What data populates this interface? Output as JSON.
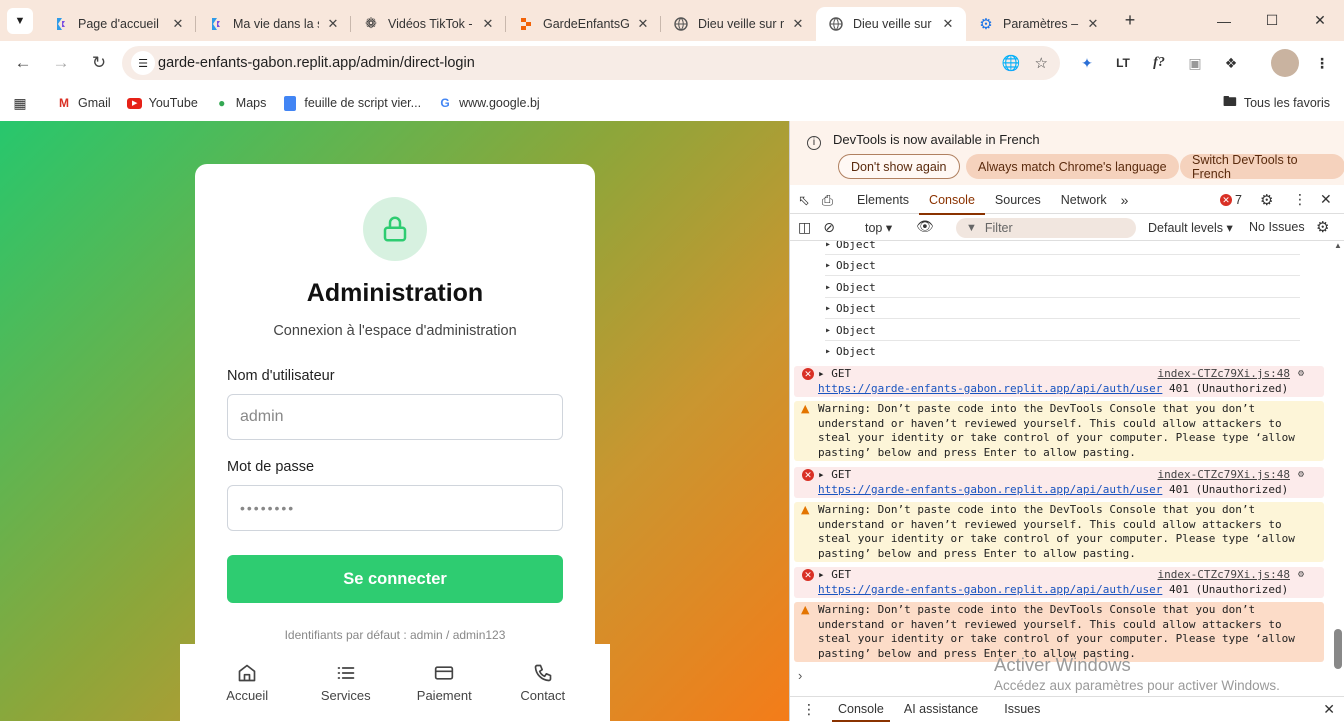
{
  "browser": {
    "tabs": [
      {
        "title": "Page d'accueil",
        "icon": "replit-icon"
      },
      {
        "title": "Ma vie dans la s",
        "icon": "replit-icon"
      },
      {
        "title": "Vidéos TikTok -",
        "icon": "chatgpt-icon"
      },
      {
        "title": "GardeEnfantsGa",
        "icon": "replit-orange-icon"
      },
      {
        "title": "Dieu veille sur m",
        "icon": "globe-icon"
      },
      {
        "title": "Dieu veille sur m",
        "icon": "globe-icon",
        "active": true
      },
      {
        "title": "Paramètres – Co",
        "icon": "gear-icon"
      }
    ],
    "url": "garde-enfants-gabon.replit.app/admin/direct-login",
    "bookmarks": [
      "Gmail",
      "YouTube",
      "Maps",
      "feuille de script vier...",
      "www.google.bj"
    ],
    "all_bookmarks": "Tous les favoris"
  },
  "login": {
    "title": "Administration",
    "subtitle": "Connexion à l'espace d'administration",
    "username_label": "Nom d'utilisateur",
    "username_value": "admin",
    "password_label": "Mot de passe",
    "password_value": "••••••••",
    "submit": "Se connecter",
    "hint": "Identifiants par défaut : admin / admin123"
  },
  "bottom_nav": [
    {
      "label": "Accueil",
      "icon": "home-icon"
    },
    {
      "label": "Services",
      "icon": "list-icon"
    },
    {
      "label": "Paiement",
      "icon": "card-icon"
    },
    {
      "label": "Contact",
      "icon": "phone-icon"
    }
  ],
  "devtools": {
    "info_text": "DevTools is now available in French",
    "info_buttons": [
      "Don't show again",
      "Always match Chrome's language",
      "Switch DevTools to French"
    ],
    "tabs": [
      "Elements",
      "Console",
      "Sources",
      "Network"
    ],
    "error_count": "7",
    "context": "top",
    "filter_placeholder": "Filter",
    "levels": "Default levels",
    "issues": "No Issues",
    "objects": [
      "Object",
      "Object",
      "Object",
      "Object",
      "Object",
      "Object"
    ],
    "get": "GET",
    "source": "index-CTZc79Xi.js:48",
    "error_url": "https://garde-enfants-gabon.replit.app/api/auth/user",
    "error_status": "401 (Unauthorized)",
    "warning_lines": [
      "Warning: Don’t paste code into the DevTools Console that you don’t",
      "understand or haven’t reviewed yourself. This could allow attackers to",
      "steal your identity or take control of your computer. Please type ‘allow",
      "pasting’ below and press Enter to allow pasting."
    ],
    "watermark_title": "Activer Windows",
    "watermark_sub": "Accédez aux paramètres pour activer Windows.",
    "drawer_tabs": [
      "Console",
      "AI assistance",
      "Issues"
    ]
  }
}
